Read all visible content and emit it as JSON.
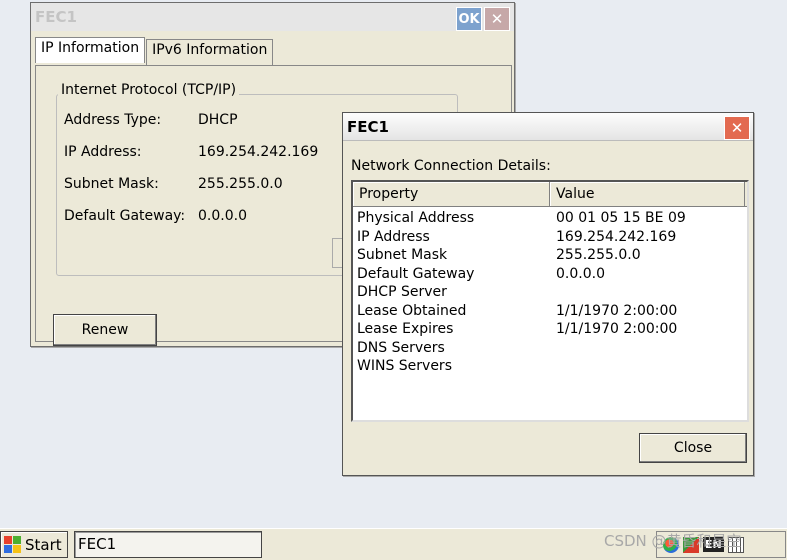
{
  "background_window": {
    "title": "FEC1",
    "ok_label": "OK",
    "close_glyph": "✕",
    "tabs": [
      {
        "label": "IP Information",
        "active": true
      },
      {
        "label": "IPv6 Information",
        "active": false
      }
    ],
    "group_label": "Internet Protocol (TCP/IP)",
    "fields": [
      {
        "label": "Address Type:",
        "value": "DHCP"
      },
      {
        "label": "IP Address:",
        "value": "169.254.242.169"
      },
      {
        "label": "Subnet Mask:",
        "value": "255.255.0.0"
      },
      {
        "label": "Default Gateway:",
        "value": "0.0.0.0"
      }
    ],
    "renew_label": "Renew"
  },
  "details_window": {
    "title": "FEC1",
    "close_glyph": "✕",
    "caption": "Network Connection Details:",
    "columns": [
      "Property",
      "Value"
    ],
    "rows": [
      {
        "property": "Physical Address",
        "value": "00 01 05 15 BE 09"
      },
      {
        "property": "IP Address",
        "value": "169.254.242.169"
      },
      {
        "property": "Subnet Mask",
        "value": "255.255.0.0"
      },
      {
        "property": "Default Gateway",
        "value": "0.0.0.0"
      },
      {
        "property": "DHCP Server",
        "value": ""
      },
      {
        "property": "Lease Obtained",
        "value": "1/1/1970 2:00:00"
      },
      {
        "property": "Lease Expires",
        "value": "1/1/1970 2:00:00"
      },
      {
        "property": "DNS Servers",
        "value": ""
      },
      {
        "property": "WINS Servers",
        "value": ""
      }
    ],
    "close_label": "Close"
  },
  "taskbar": {
    "start_label": "Start",
    "task_item": "FEC1",
    "language": "EN"
  },
  "watermark": "CSDN @黄昏和星空",
  "colors": {
    "window_face": "#ece9d8",
    "close_button": "#e36a50",
    "ok_button": "#7da2ce"
  }
}
